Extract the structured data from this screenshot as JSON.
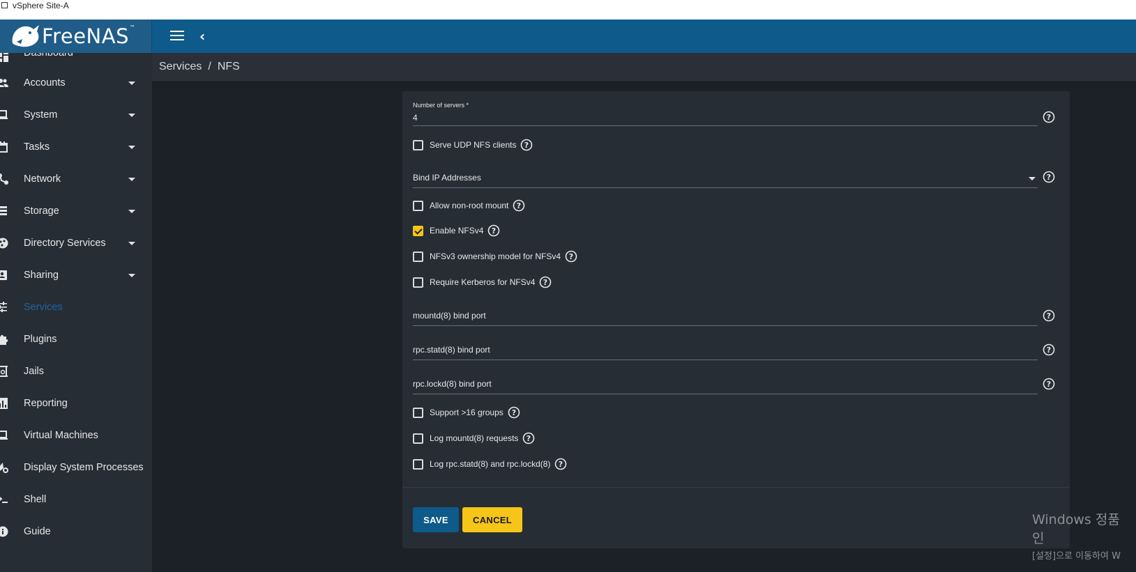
{
  "window": {
    "title": "vSphere Site-A"
  },
  "brand": {
    "name": "FreeNAS",
    "trademark": "™"
  },
  "breadcrumb": {
    "parent": "Services",
    "separator": "/",
    "current": "NFS"
  },
  "sidebar": {
    "items": [
      {
        "label": "Dashboard",
        "icon": "dashboard-icon",
        "expandable": false
      },
      {
        "label": "Accounts",
        "icon": "people-icon",
        "expandable": true
      },
      {
        "label": "System",
        "icon": "laptop-icon",
        "expandable": true
      },
      {
        "label": "Tasks",
        "icon": "calendar-icon",
        "expandable": true
      },
      {
        "label": "Network",
        "icon": "network-icon",
        "expandable": true
      },
      {
        "label": "Storage",
        "icon": "storage-icon",
        "expandable": true
      },
      {
        "label": "Directory Services",
        "icon": "directory-icon",
        "expandable": true
      },
      {
        "label": "Sharing",
        "icon": "sharing-icon",
        "expandable": true
      },
      {
        "label": "Services",
        "icon": "tune-icon",
        "expandable": false,
        "active": true
      },
      {
        "label": "Plugins",
        "icon": "puzzle-icon",
        "expandable": false
      },
      {
        "label": "Jails",
        "icon": "jail-icon",
        "expandable": false
      },
      {
        "label": "Reporting",
        "icon": "chart-icon",
        "expandable": false
      },
      {
        "label": "Virtual Machines",
        "icon": "computer-icon",
        "expandable": false
      },
      {
        "label": "Display System Processes",
        "icon": "processes-icon",
        "expandable": false
      },
      {
        "label": "Shell",
        "icon": "shell-icon",
        "expandable": false
      },
      {
        "label": "Guide",
        "icon": "info-icon",
        "expandable": false
      }
    ]
  },
  "form": {
    "servers": {
      "label": "Number of servers *",
      "value": "4"
    },
    "serve_udp": {
      "label": "Serve UDP NFS clients",
      "checked": false
    },
    "bind_ip": {
      "placeholder": "Bind IP Addresses"
    },
    "allow_nonroot": {
      "label": "Allow non-root mount",
      "checked": false
    },
    "enable_nfsv4": {
      "label": "Enable NFSv4",
      "checked": true
    },
    "nfsv3_ownership": {
      "label": "NFSv3 ownership model for NFSv4",
      "checked": false
    },
    "require_kerberos": {
      "label": "Require Kerberos for NFSv4",
      "checked": false
    },
    "mountd_port": {
      "placeholder": "mountd(8) bind port"
    },
    "statd_port": {
      "placeholder": "rpc.statd(8) bind port"
    },
    "lockd_port": {
      "placeholder": "rpc.lockd(8) bind port"
    },
    "support_16_groups": {
      "label": "Support >16 groups",
      "checked": false
    },
    "log_mountd": {
      "label": "Log mountd(8) requests",
      "checked": false
    },
    "log_statd_lockd": {
      "label": "Log rpc.statd(8) and rpc.lockd(8)",
      "checked": false
    },
    "save_label": "SAVE",
    "cancel_label": "CANCEL"
  },
  "colors": {
    "header": "#0e5a8a",
    "sidebar": "#272d35",
    "card": "#272d35",
    "accent": "#f5c518",
    "active_nav": "#1e64a0"
  },
  "watermark": {
    "line1": "Windows 정품 인",
    "line2": "[설정]으로 이동하여 W"
  }
}
